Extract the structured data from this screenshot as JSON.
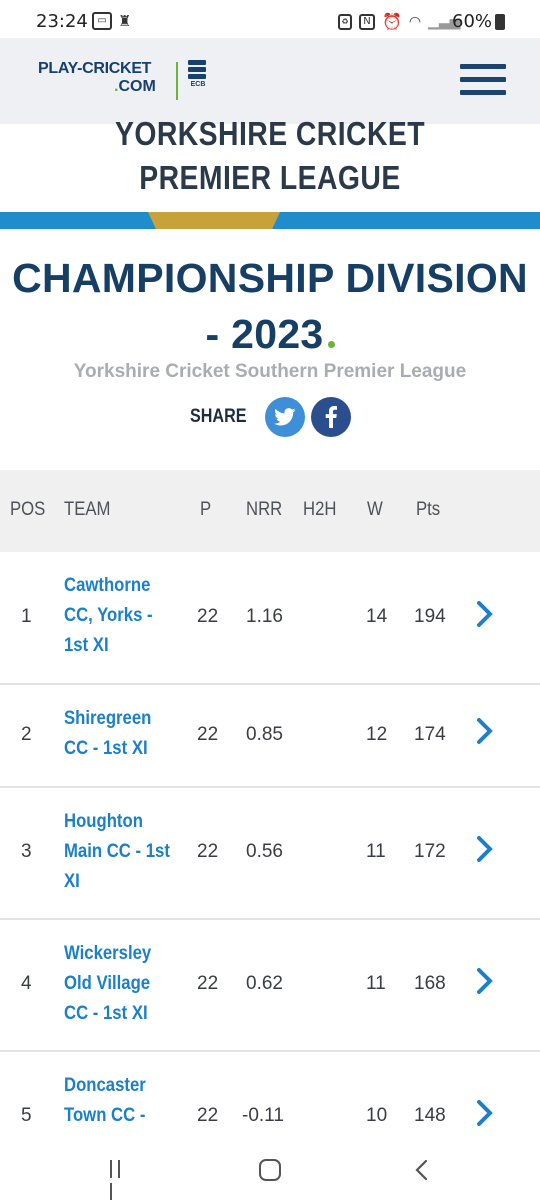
{
  "status_bar": {
    "time": "23:24",
    "battery": "60%",
    "left_icons": [
      "cast-icon",
      "notification-icon"
    ],
    "right_icons": [
      "recycle-icon",
      "nfc-icon",
      "alarm-icon",
      "wifi-icon",
      "signal-icon"
    ]
  },
  "header": {
    "logo_line1": "PLAY-CRICKET",
    "logo_line2_dot": ".",
    "logo_line2": "COM",
    "ecb_label": "ECB"
  },
  "league_title": {
    "line1": "YORKSHIRE CRICKET SOUTHERN",
    "line2": "PREMIER LEAGUE"
  },
  "division": {
    "line1": "CHAMPIONSHIP DIVISION",
    "line2": "- 2023"
  },
  "league_subtitle": "Yorkshire Cricket Southern Premier League",
  "share": {
    "label": "SHARE"
  },
  "table": {
    "columns": [
      "POS",
      "TEAM",
      "P",
      "NRR",
      "H2H",
      "W",
      "Pts"
    ],
    "rows": [
      {
        "pos": "1",
        "team_lines": [
          "Cawthorne",
          "CC, Yorks -",
          "1st XI"
        ],
        "p": "22",
        "nrr": "1.16",
        "h2h": "",
        "w": "14",
        "pts": "194"
      },
      {
        "pos": "2",
        "team_lines": [
          "Shiregreen",
          "CC - 1st XI"
        ],
        "p": "22",
        "nrr": "0.85",
        "h2h": "",
        "w": "12",
        "pts": "174"
      },
      {
        "pos": "3",
        "team_lines": [
          "Houghton",
          "Main CC - 1st",
          "XI"
        ],
        "p": "22",
        "nrr": "0.56",
        "h2h": "",
        "w": "11",
        "pts": "172"
      },
      {
        "pos": "4",
        "team_lines": [
          "Wickersley",
          "Old Village",
          "CC - 1st XI"
        ],
        "p": "22",
        "nrr": "0.62",
        "h2h": "",
        "w": "11",
        "pts": "168"
      },
      {
        "pos": "5",
        "team_lines": [
          "Doncaster",
          "Town CC -"
        ],
        "p": "22",
        "nrr": "-0.11",
        "h2h": "",
        "w": "10",
        "pts": "148"
      }
    ]
  },
  "colors": {
    "brand_navy": "#173f66",
    "link_blue": "#1b80c9",
    "stripe_blue": "#1f8ccb",
    "stripe_gold": "#c7a13a",
    "accent_green": "#6cb33e"
  }
}
